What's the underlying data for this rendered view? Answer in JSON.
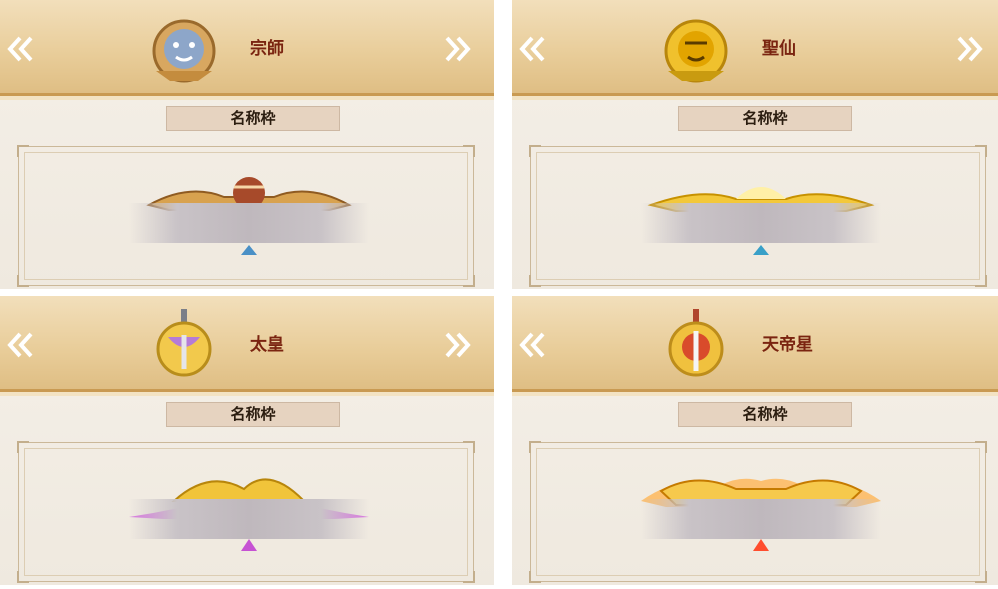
{
  "panels": [
    {
      "title": "宗師",
      "subtitle": "名称枠",
      "prev_icon": "double-chevron-left-icon",
      "next_icon": "double-chevron-right-icon",
      "emblem_icon": "lion-head-emblem-icon",
      "ornament_icon": "tiger-nameplate-ornament",
      "accent": "#c98a3a"
    },
    {
      "title": "聖仙",
      "subtitle": "名称枠",
      "prev_icon": "double-chevron-left-icon",
      "next_icon": "double-chevron-right-icon",
      "emblem_icon": "golden-tiger-emblem-icon",
      "ornament_icon": "golden-tiger-nameplate-ornament",
      "accent": "#e0b020"
    },
    {
      "title": "太皇",
      "subtitle": "名称枠",
      "prev_icon": "double-chevron-left-icon",
      "next_icon": "double-chevron-right-icon",
      "emblem_icon": "sword-wings-emblem-icon",
      "ornament_icon": "phoenix-nameplate-ornament",
      "accent": "#b070d0"
    },
    {
      "title": "天帝星",
      "subtitle": "名称枠",
      "prev_icon": "double-chevron-left-icon",
      "next_icon": null,
      "emblem_icon": "sword-red-lion-emblem-icon",
      "ornament_icon": "fire-dragon-nameplate-ornament",
      "accent": "#e85a20"
    }
  ]
}
